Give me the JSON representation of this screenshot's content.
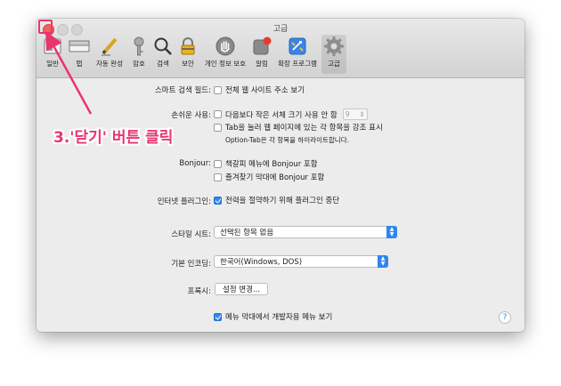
{
  "window": {
    "title": "고급"
  },
  "toolbar": {
    "items": [
      {
        "label": "일반",
        "icon": "general-icon"
      },
      {
        "label": "탭",
        "icon": "tabs-icon"
      },
      {
        "label": "자동 완성",
        "icon": "pencil-icon"
      },
      {
        "label": "암호",
        "icon": "key-icon"
      },
      {
        "label": "검색",
        "icon": "search-icon"
      },
      {
        "label": "보안",
        "icon": "lock-icon"
      },
      {
        "label": "개인 정보 보호",
        "icon": "hand-icon"
      },
      {
        "label": "알림",
        "icon": "notification-icon"
      },
      {
        "label": "확장 프로그램",
        "icon": "extensions-icon"
      },
      {
        "label": "고급",
        "icon": "gear-icon",
        "selected": true
      }
    ]
  },
  "smart_search": {
    "label": "스마트 검색 필드:",
    "show_full_url": {
      "label": "전체 웹 사이트 주소 보기",
      "checked": false
    }
  },
  "accessibility": {
    "label": "손쉬운 사용:",
    "min_font": {
      "label": "다음보다 작은 서체 크기 사용 안 함",
      "checked": false,
      "value": "9"
    },
    "tab_highlight": {
      "label": "Tab을 눌러 웹 페이지에 있는 각 항목을 강조 표시",
      "checked": false
    },
    "hint": "Option-Tab은 각 항목을 하이라이트합니다."
  },
  "bonjour": {
    "label": "Bonjour:",
    "bookmarks_menu": {
      "label": "책갈피 메뉴에 Bonjour 포함",
      "checked": false
    },
    "favorites_bar": {
      "label": "즐겨찾기 막대에 Bonjour 포함",
      "checked": false
    }
  },
  "plugins": {
    "label": "인터넷 플러그인:",
    "stop_plugins": {
      "label": "전력을 절약하기 위해 플러그인 중단",
      "checked": true
    }
  },
  "stylesheet": {
    "label": "스타일 시트:",
    "value": "선택된 항목 없음"
  },
  "encoding": {
    "label": "기본 인코딩:",
    "value": "한국어(Windows, DOS)"
  },
  "proxy": {
    "label": "프록시:",
    "button": "설정 변경..."
  },
  "develop_menu": {
    "label": "메뉴 막대에서 개발자용 메뉴 보기",
    "checked": true
  },
  "help": {
    "label": "?"
  },
  "annotation": {
    "text": "3.'닫기' 버튼 클릭",
    "color": "#e8356f"
  },
  "colors": {
    "accent": "#2f86ef",
    "close": "#f4605a",
    "annotation": "#e8356f"
  }
}
